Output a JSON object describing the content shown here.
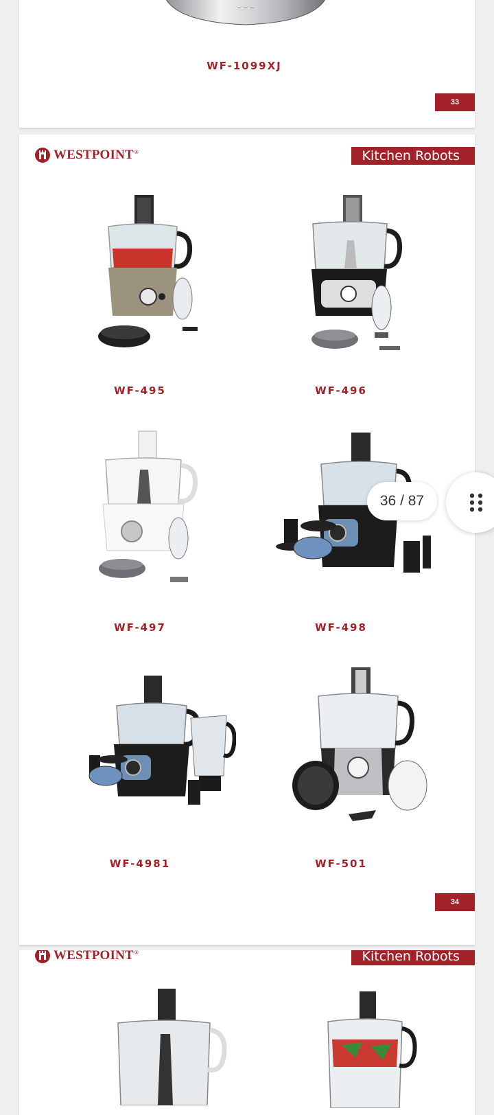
{
  "viewer": {
    "page_indicator": "36 / 87",
    "grid_icon": "dots-grid-icon"
  },
  "pages": {
    "top": {
      "model": "WF-1099XJ",
      "page_number": "33"
    },
    "main": {
      "brand": "WESTPOINT",
      "brand_reg": "®",
      "category": "Kitchen Robots",
      "products": [
        {
          "model": "WF-495"
        },
        {
          "model": "WF-496"
        },
        {
          "model": "WF-497"
        },
        {
          "model": "WF-498"
        },
        {
          "model": "WF-4981"
        },
        {
          "model": "WF-501"
        }
      ],
      "page_number": "34"
    },
    "next": {
      "brand": "WESTPOINT",
      "brand_reg": "®",
      "category": "Kitchen Robots"
    }
  },
  "colors": {
    "brand_red": "#a3222a",
    "background": "#eeeff1"
  }
}
